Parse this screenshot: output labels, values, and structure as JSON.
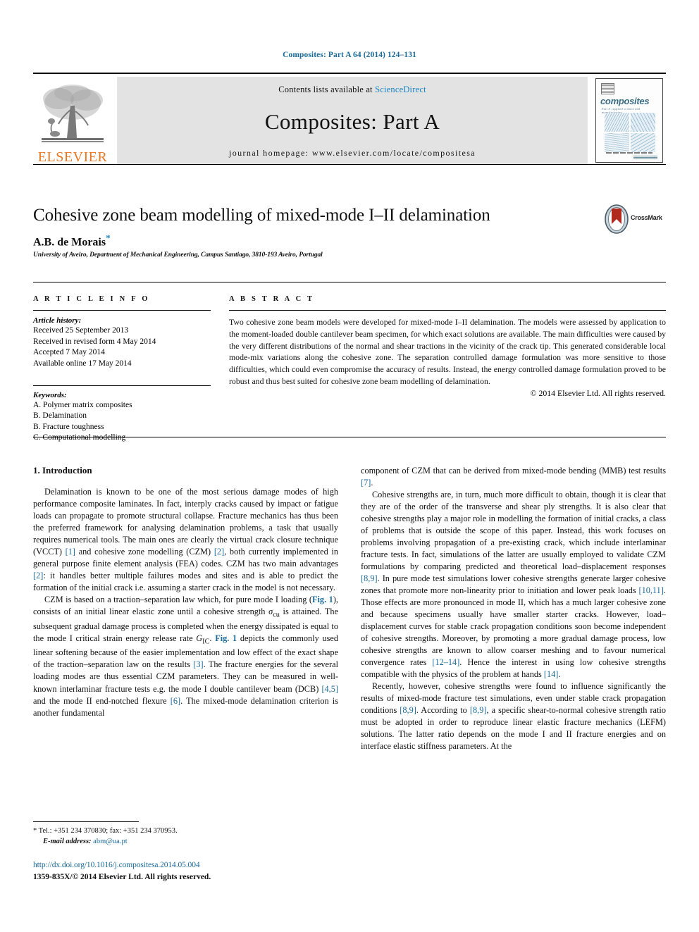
{
  "running_head": "Composites: Part A 64 (2014) 124–131",
  "masthead": {
    "publisher_logo_label": "ELSEVIER",
    "contents_prefix": "Contents lists available at ",
    "contents_link": "ScienceDirect",
    "journal_name": "Composites: Part A",
    "homepage_line": "journal homepage: www.elsevier.com/locate/compositesa",
    "cover": {
      "title": "composites",
      "subtitle": "Part A: applied science and manufacturing"
    }
  },
  "article": {
    "title": "Cohesive zone beam modelling of mixed-mode I–II delamination",
    "author": "A.B. de Morais",
    "author_marker": "*",
    "affiliation": "University of Aveiro, Department of Mechanical Engineering, Campus Santiago, 3810-193 Aveiro, Portugal",
    "crossmark_label": "CrossMark"
  },
  "article_info": {
    "heading": "A R T I C L E   I N F O",
    "history_label": "Article history:",
    "history": [
      "Received 25 September 2013",
      "Received in revised form 4 May 2014",
      "Accepted 7 May 2014",
      "Available online 17 May 2014"
    ],
    "keywords_label": "Keywords:",
    "keywords": [
      "A. Polymer matrix composites",
      "B. Delamination",
      "B. Fracture toughness",
      "C. Computational modelling"
    ]
  },
  "abstract": {
    "heading": "A B S T R A C T",
    "text": "Two cohesive zone beam models were developed for mixed-mode I–II delamination. The models were assessed by application to the moment-loaded double cantilever beam specimen, for which exact solutions are available. The main difficulties were caused by the very different distributions of the normal and shear tractions in the vicinity of the crack tip. This generated considerable local mode-mix variations along the cohesive zone. The separation controlled damage formulation was more sensitive to those difficulties, which could even compromise the accuracy of results. Instead, the energy controlled damage formulation proved to be robust and thus best suited for cohesive zone beam modelling of delamination.",
    "copyright": "© 2014 Elsevier Ltd. All rights reserved."
  },
  "body": {
    "section_heading": "1. Introduction",
    "left_paragraphs": [
      "Delamination is known to be one of the most serious damage modes of high performance composite laminates. In fact, interply cracks caused by impact or fatigue loads can propagate to promote structural collapse. Fracture mechanics has thus been the preferred framework for analysing delamination problems, a task that usually requires numerical tools. The main ones are clearly the virtual crack closure technique (VCCT) [1] and cohesive zone modelling (CZM) [2], both currently implemented in general purpose finite element analysis (FEA) codes. CZM has two main advantages [2]: it handles better multiple failures modes and sites and is able to predict the formation of the initial crack i.e. assuming a starter crack in the model is not necessary.",
      "CZM is based on a traction–separation law which, for pure mode I loading (Fig. 1), consists of an initial linear elastic zone until a cohesive strength σcu is attained. The subsequent gradual damage process is completed when the energy dissipated is equal to the mode I critical strain energy release rate GIC. Fig. 1 depicts the commonly used linear softening because of the easier implementation and low effect of the exact shape of the traction–separation law on the results [3]. The fracture energies for the several loading modes are thus essential CZM parameters. They can be measured in well-known interlaminar fracture tests e.g. the mode I double cantilever beam (DCB) [4,5] and the mode II end-notched flexure [6]. The mixed-mode delamination criterion is another fundamental"
    ],
    "right_paragraphs": [
      "component of CZM that can be derived from mixed-mode bending (MMB) test results [7].",
      "Cohesive strengths are, in turn, much more difficult to obtain, though it is clear that they are of the order of the transverse and shear ply strengths. It is also clear that cohesive strengths play a major role in modelling the formation of initial cracks, a class of problems that is outside the scope of this paper. Instead, this work focuses on problems involving propagation of a pre-existing crack, which include interlaminar fracture tests. In fact, simulations of the latter are usually employed to validate CZM formulations by comparing predicted and theoretical load–displacement responses [8,9]. In pure mode test simulations lower cohesive strengths generate larger cohesive zones that promote more non-linearity prior to initiation and lower peak loads [10,11]. Those effects are more pronounced in mode II, which has a much larger cohesive zone and because specimens usually have smaller starter cracks. However, load–displacement curves for stable crack propagation conditions soon become independent of cohesive strengths. Moreover, by promoting a more gradual damage process, low cohesive strengths are known to allow coarser meshing and to favour numerical convergence rates [12–14]. Hence the interest in using low cohesive strengths compatible with the physics of the problem at hands [14].",
      "Recently, however, cohesive strengths were found to influence significantly the results of mixed-mode fracture test simulations, even under stable crack propagation conditions [8,9]. According to [8,9], a specific shear-to-normal cohesive strength ratio must be adopted in order to reproduce linear elastic fracture mechanics (LEFM) solutions. The latter ratio depends on the mode I and II fracture energies and on interface elastic stiffness parameters. At the"
    ]
  },
  "footer": {
    "correspondence": "* Tel.: +351 234 370830; fax: +351 234 370953.",
    "email_label": "E-mail address:",
    "email": "abm@ua.pt",
    "doi": "http://dx.doi.org/10.1016/j.compositesa.2014.05.004",
    "issn_copyright": "1359-835X/© 2014 Elsevier Ltd. All rights reserved."
  },
  "colors": {
    "link": "#1a6a9a",
    "science_direct": "#1a86c4",
    "elsevier_orange": "#E87722",
    "band_gray": "#e3e3e3"
  }
}
